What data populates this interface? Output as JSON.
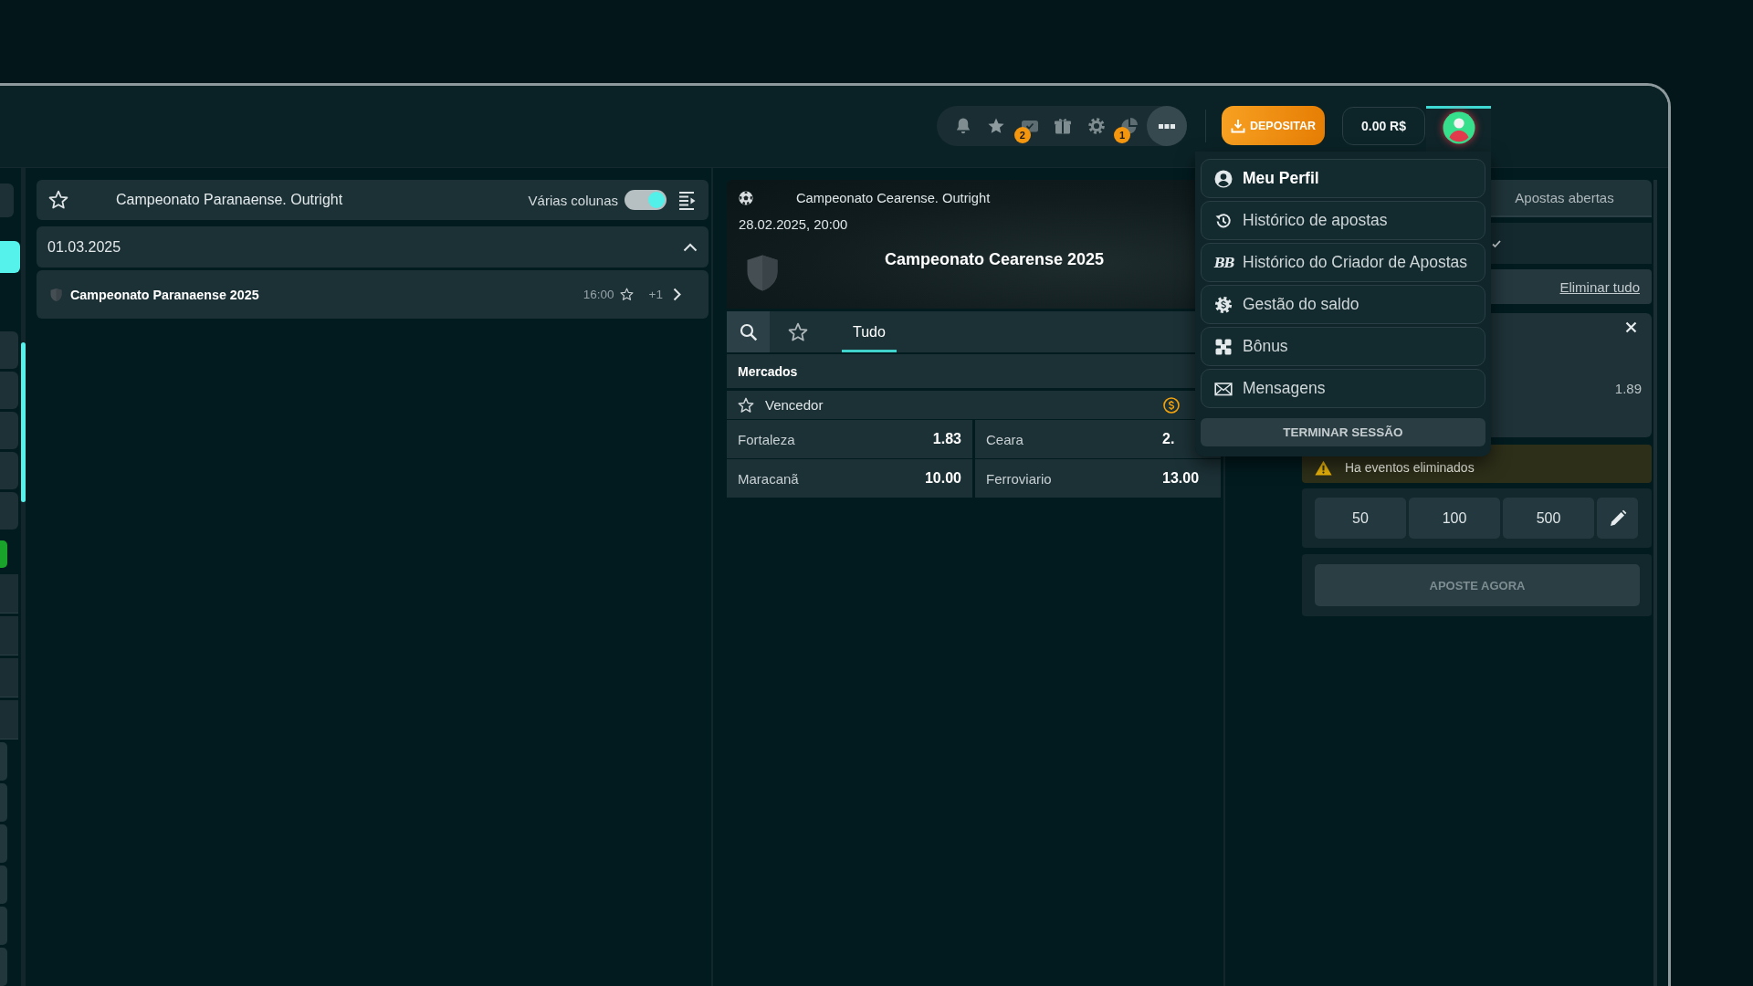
{
  "header": {
    "toolbar": [
      {
        "kind": "bell"
      },
      {
        "kind": "star"
      },
      {
        "kind": "ticket",
        "badge": "2"
      },
      {
        "kind": "gift"
      },
      {
        "kind": "gear"
      },
      {
        "kind": "pie",
        "badge": "1"
      },
      {
        "kind": "more"
      }
    ],
    "deposit_button": "DEPOSITAR",
    "balance": "0.00 R$",
    "account_button": {
      "expanded": true
    }
  },
  "account_menu": {
    "items": [
      {
        "kind": "profile",
        "label": "Meu Perfil",
        "selected": true
      },
      {
        "kind": "history",
        "label": "Histórico de apostas",
        "selected": false
      },
      {
        "kind": "builder",
        "glyph": "BB",
        "label": "Histórico do Criador de Apostas",
        "selected": false
      },
      {
        "kind": "balance",
        "label": "Gestão do saldo",
        "selected": false
      },
      {
        "kind": "bonus",
        "label": "Bônus",
        "selected": false
      },
      {
        "kind": "messages",
        "label": "Mensagens",
        "selected": false
      }
    ],
    "logout_button": "TERMINAR SESSÃO"
  },
  "left_rail": {
    "tabs": [
      {
        "selected": false
      },
      {
        "selected": true
      }
    ],
    "items": [
      {
        "kind": "tile"
      },
      {
        "kind": "tile"
      },
      {
        "kind": "tile"
      },
      {
        "kind": "tile"
      },
      {
        "kind": "tile"
      },
      {
        "kind": "marker"
      },
      {
        "kind": "row"
      },
      {
        "kind": "row"
      },
      {
        "kind": "row"
      },
      {
        "kind": "row"
      },
      {
        "kind": "mini"
      },
      {
        "kind": "mini"
      },
      {
        "kind": "mini"
      },
      {
        "kind": "mini"
      },
      {
        "kind": "mini"
      },
      {
        "kind": "mini"
      }
    ]
  },
  "left_panel": {
    "header": {
      "favorite": false,
      "title": "Campeonato Paranaense. Outright",
      "columns_label": "Várias colunas",
      "columns_toggle": {
        "on": true
      }
    },
    "date_group": {
      "date": "01.03.2025",
      "expanded": true,
      "events": [
        {
          "name": "Campeonato Paranaense 2025",
          "time": "16:00",
          "favorite": false,
          "extra_markets": "+1"
        }
      ]
    }
  },
  "event": {
    "league": "Campeonato Cearense. Outright",
    "datetime": "28.02.2025, 20:00",
    "title": "Campeonato Cearense 2025",
    "tabs": [
      {
        "label": "Tudo",
        "selected": true
      }
    ],
    "markets_title": "Mercados",
    "market": {
      "name": "Vencedor",
      "favorite": false,
      "outcomes": [
        {
          "name": "Fortaleza",
          "odds": "1.83"
        },
        {
          "name": "Ceara",
          "odds": "2."
        },
        {
          "name": "Maracanã",
          "odds": "10.00"
        },
        {
          "name": "Ferroviario",
          "odds": "13.00"
        }
      ]
    }
  },
  "bet_slip": {
    "tabs": [
      {
        "label": "Apostas abertas",
        "selected": false
      }
    ],
    "clear_all": "Eliminar tudo",
    "selections": [
      {
        "odds": "1.89"
      }
    ],
    "warning": "Ha eventos eliminados",
    "stakes": [
      "50",
      "100",
      "500"
    ],
    "place_bet": {
      "label": "APOSTE AGORA",
      "disabled": true
    }
  }
}
